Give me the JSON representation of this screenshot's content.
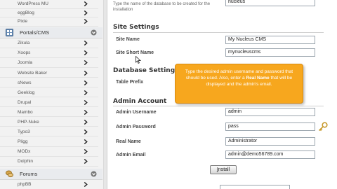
{
  "sidebar": {
    "items_top": [
      {
        "label": "WordPress MU"
      },
      {
        "label": "eggBlog"
      },
      {
        "label": "Pixie"
      }
    ],
    "category_portals": {
      "label": "Portals/CMS"
    },
    "items_cms": [
      {
        "label": "Zikula"
      },
      {
        "label": "Xoops"
      },
      {
        "label": "Joomla"
      },
      {
        "label": "Website Baker"
      },
      {
        "label": "sNews"
      },
      {
        "label": "Geeklog"
      },
      {
        "label": "Drupal"
      },
      {
        "label": "Mambo"
      },
      {
        "label": "PHP-Nuke"
      },
      {
        "label": "Typo3"
      },
      {
        "label": "Pligg"
      },
      {
        "label": "MODx"
      },
      {
        "label": "Dolphin"
      }
    ],
    "category_forums": {
      "label": "Forums"
    },
    "items_forums": [
      {
        "label": "phpBB"
      }
    ]
  },
  "main": {
    "db_hint": "Type the name of the database to be created for the installation",
    "db_name_value": "nucleus",
    "site_settings": {
      "heading": "Site Settings",
      "site_name_label": "Site Name",
      "site_name_value": "My Nucleus CMS",
      "site_short_name_label": "Site Short Name",
      "site_short_name_value": "mynucleuscms"
    },
    "database_settings": {
      "heading": "Database Settings",
      "table_prefix_label": "Table Prefix"
    },
    "admin_account": {
      "heading": "Admin Account",
      "username_label": "Admin Username",
      "username_value": "admin",
      "password_label": "Admin Password",
      "password_value": "pass",
      "real_name_label": "Real Name",
      "real_name_value": "Administrator",
      "email_label": "Admin Email",
      "email_value": "admin@demo56789.com"
    },
    "install_button": {
      "first_letter": "I",
      "rest": "nstall"
    }
  },
  "tooltip": {
    "part1": "Type the desired admin username and password that should be used. Also, enter a",
    "bold": "Real Name",
    "part2": "that will be displayed and the admin's email."
  },
  "colors": {
    "tooltip_bg": "#f7a71e",
    "sidebar_bg": "#f2f2f2",
    "chevron": "#222222"
  }
}
